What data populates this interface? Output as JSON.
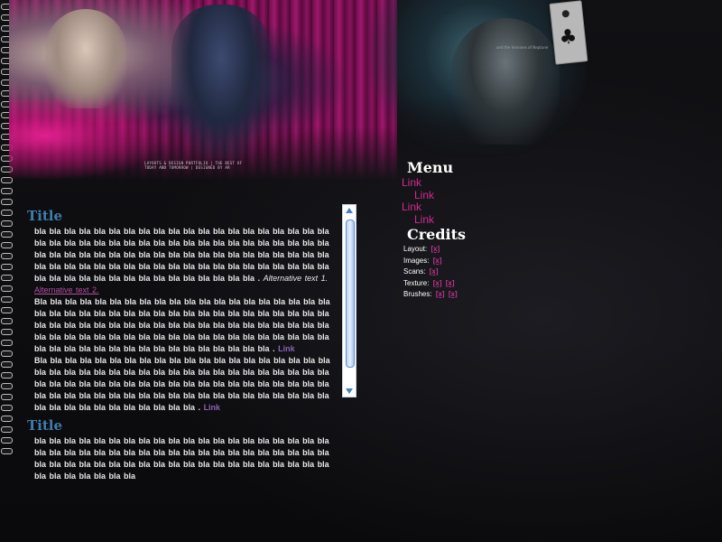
{
  "header": {
    "caption": "LAYOUTS & DESIGN PORTFOLIO | THE BEST OF TODAY AND TOMORROW | DESIGNED BY AR",
    "tagline": "and the heroines of Neptune"
  },
  "content": {
    "sections": [
      {
        "title": "Title",
        "para1": "bla bla bla bla bla bla bla bla bla bla bla bla bla bla bla bla bla bla bla bla bla bla bla bla bla bla bla bla bla bla bla bla bla bla bla bla bla bla bla bla bla bla bla bla bla bla bla bla bla bla bla bla bla bla bla bla bla bla bla bla bla bla bla bla bla bla bla bla bla bla bla bla bla bla bla bla bla bla bla bla bla bla bla bla bla bla bla bla bla bla bla bla bla bla bla",
        "alt1": "Alternative text 1.",
        "alt2": "Alternative text 2.",
        "para2": "Bla bla bla bla bla bla bla bla bla bla bla bla bla bla bla bla bla bla bla bla bla bla bla bla bla bla bla bla bla bla bla bla bla bla bla bla bla bla bla bla bla bla bla bla bla bla bla bla bla bla bla bla bla bla bla bla bla bla bla bla bla bla bla bla bla bla bla bla bla bla bla bla bla bla bla bla bla bla bla bla bla bla bla bla bla bla bla bla bla bla bla bla bla bla bla bla",
        "link": "Link",
        "para3": "Bla bla bla bla bla bla bla bla bla bla bla bla bla bla bla bla bla bla bla bla bla bla bla bla bla bla bla bla bla bla bla bla bla bla bla bla bla bla bla bla bla bla bla bla bla bla bla bla bla bla bla bla bla bla bla bla bla bla bla bla bla bla bla bla bla bla bla bla bla bla bla bla bla bla bla bla bla bla bla bla bla bla bla bla bla bla bla bla bla bla bla",
        "link2": "Link"
      },
      {
        "title": "Title",
        "para1": "bla bla bla bla bla bla bla bla bla bla bla bla bla bla bla bla bla bla bla bla bla bla bla bla bla bla bla bla bla bla bla bla bla bla bla bla bla bla bla bla bla bla bla bla bla bla bla bla bla bla bla bla bla bla bla bla bla bla bla bla bla bla bla bla bla bla bla"
      }
    ]
  },
  "menu": {
    "heading": "Menu",
    "links": [
      "Link",
      "Link",
      "Link",
      "Link"
    ]
  },
  "credits": {
    "heading": "Credits",
    "rows": [
      {
        "label": "Layout:",
        "marks": [
          "[x]"
        ]
      },
      {
        "label": "Images:",
        "marks": [
          "[x]"
        ]
      },
      {
        "label": "Scans:",
        "marks": [
          "[x]"
        ]
      },
      {
        "label": "Texture:",
        "marks": [
          "[x]",
          "[x]"
        ]
      },
      {
        "label": "Brushes:",
        "marks": [
          "[x]",
          "[x]"
        ]
      }
    ]
  },
  "colors": {
    "title": "#3c7fae",
    "link": "#d22a92",
    "background": "#0c0c0e"
  },
  "icons": {
    "tag": "club-suit-tag-icon"
  }
}
